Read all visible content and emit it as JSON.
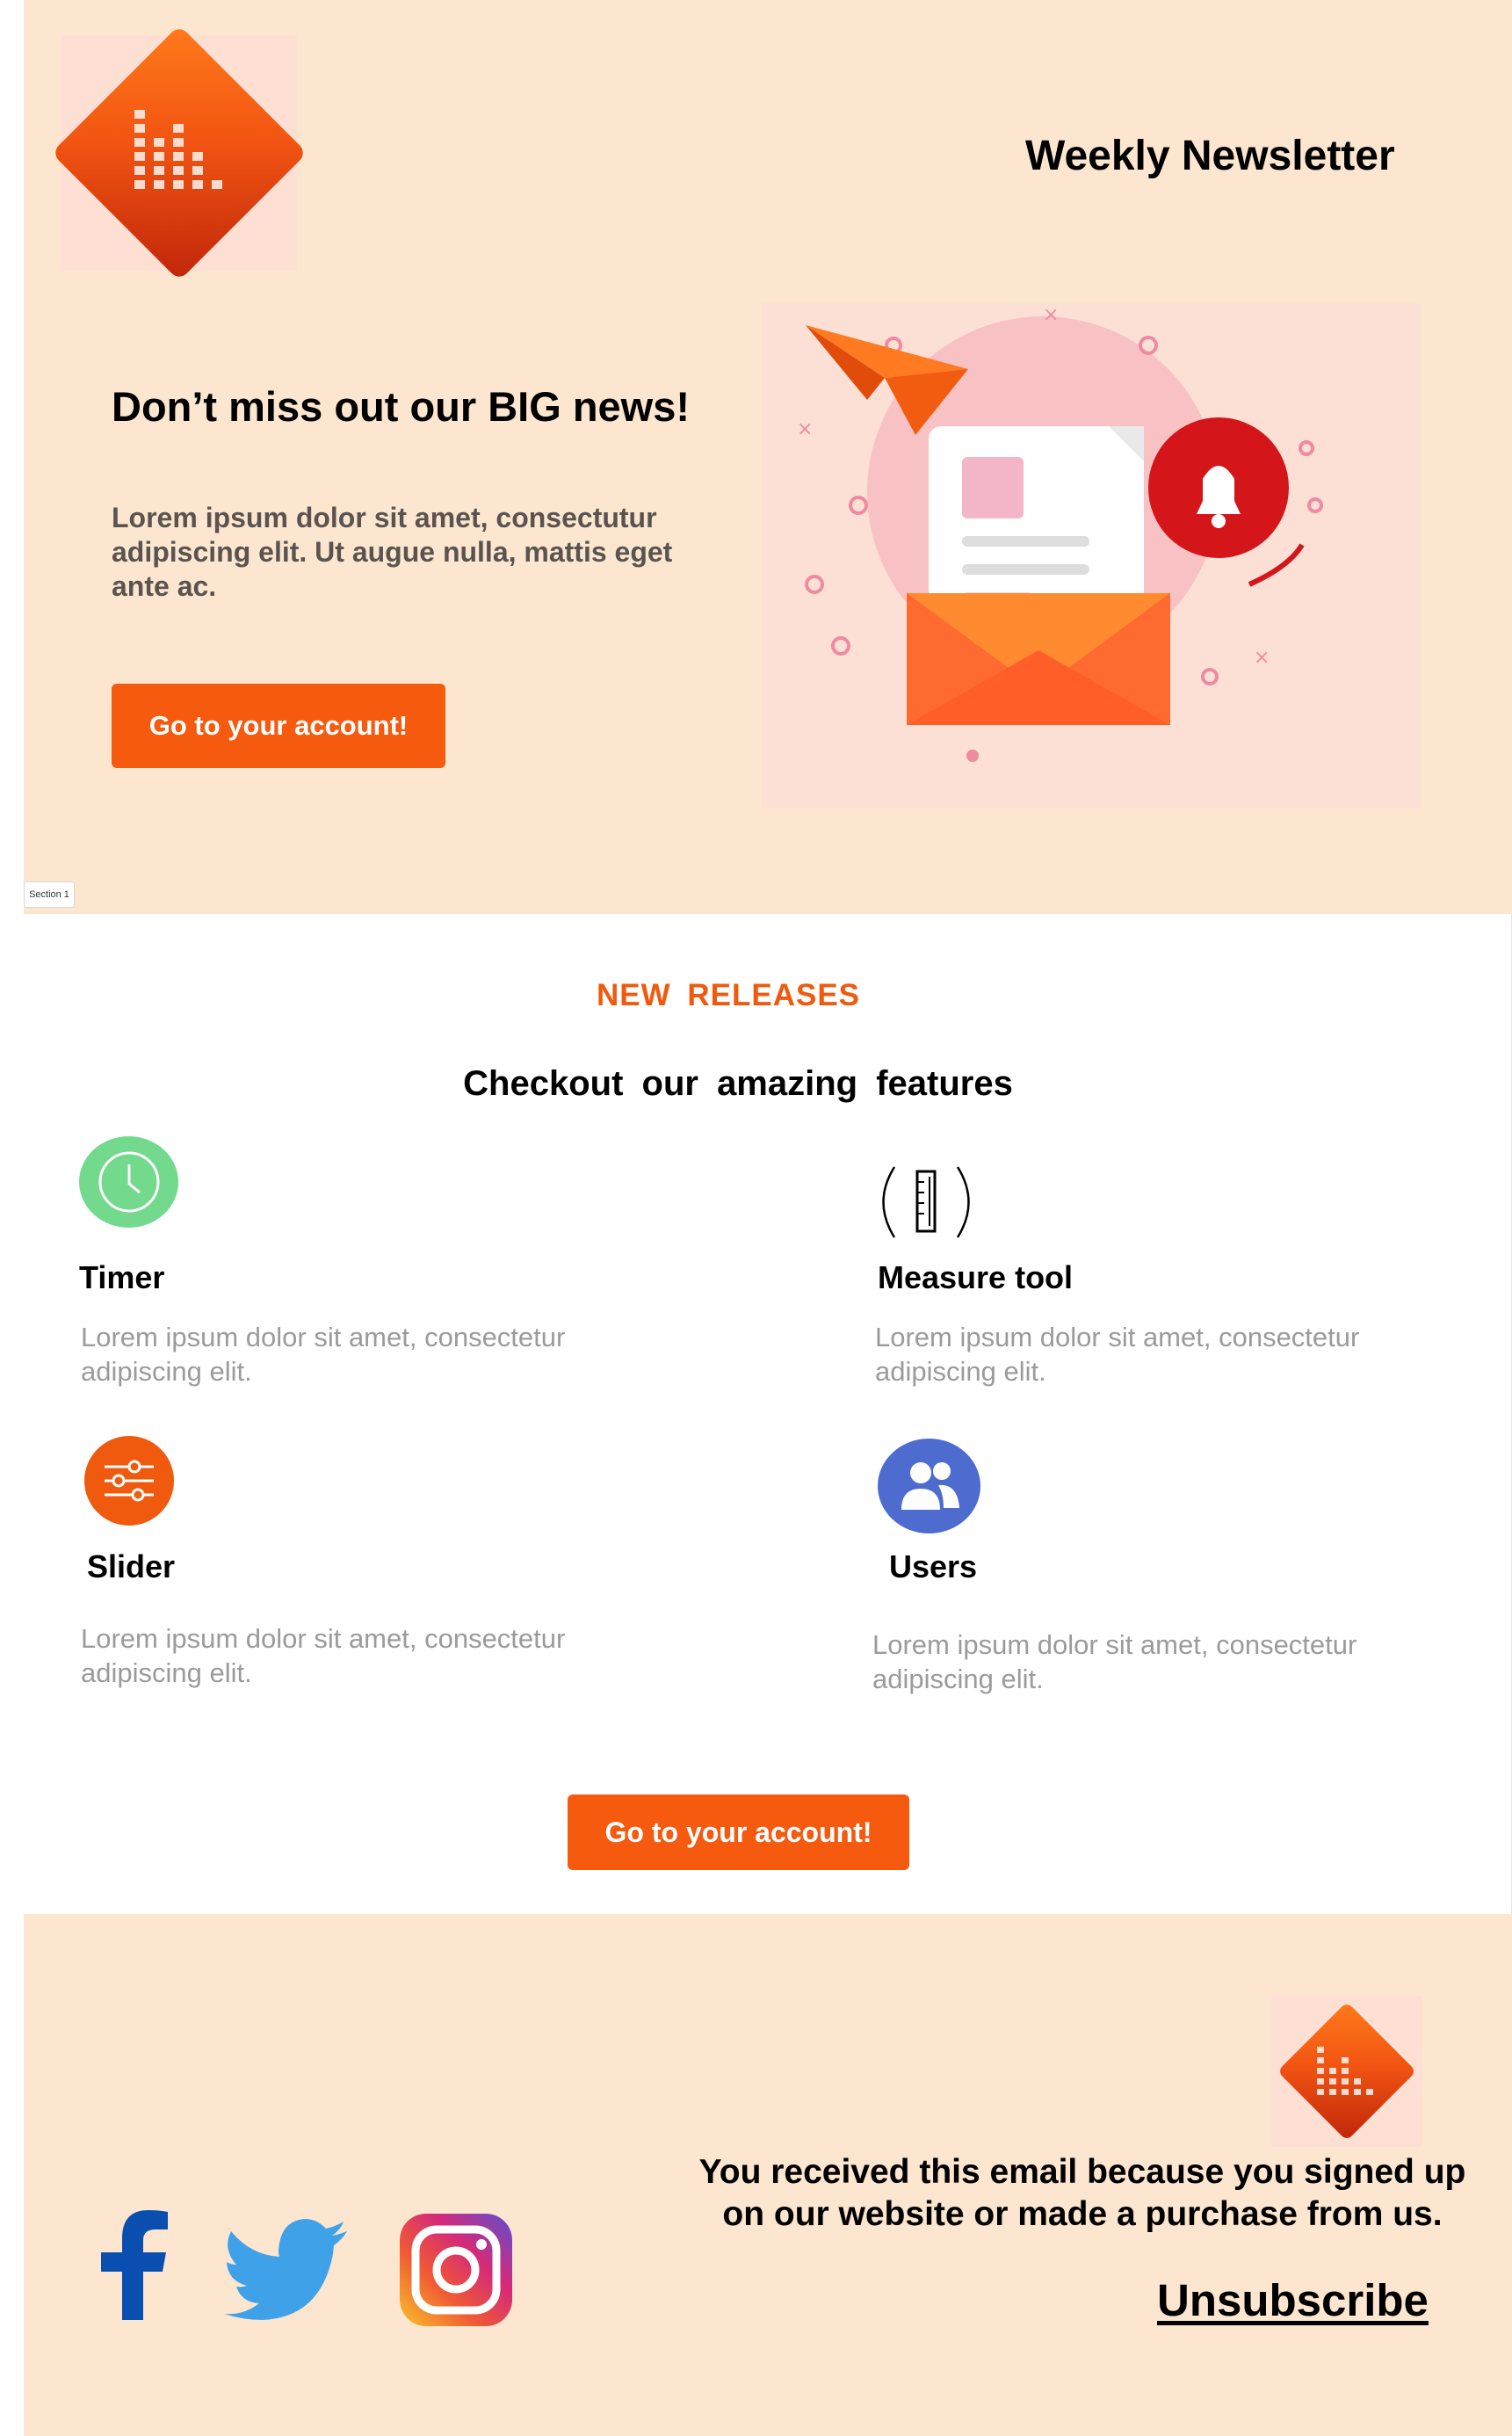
{
  "header": {
    "title": "Weekly Newsletter",
    "headline": "Don’t miss out our BIG news!",
    "body": "Lorem ipsum dolor sit amet,  consectutur adipiscing elit. Ut augue nulla, mattis eget ante ac.",
    "button_label": "Go to your account!",
    "section_tag": "Section 1"
  },
  "features": {
    "eyebrow": "NEW  RELEASES",
    "heading": "Checkout  our  amazing  features",
    "items": [
      {
        "icon": "clock-icon",
        "title": "Timer",
        "description": "Lorem  ipsum dolor sit amet,  consectetur adipiscing elit.",
        "color": "#6fd88a"
      },
      {
        "icon": "ruler-pencil-icon",
        "title": "Measure tool",
        "description": "Lorem  ipsum dolor sit amet,  consectetur adipiscing elit.",
        "color": "#000000"
      },
      {
        "icon": "sliders-icon",
        "title": "Slider",
        "description": "Lorem  ipsum dolor sit amet,  consectetur adipiscing elit.",
        "color": "#f05a0e"
      },
      {
        "icon": "users-icon",
        "title": "Users",
        "description": "Lorem  ipsum dolor sit amet,  consectetur adipiscing elit.",
        "color": "#4a6ad0"
      }
    ],
    "button_label": "Go to your account!"
  },
  "footer": {
    "note": "You received this email because you signed up on our website or made a purchase from us.",
    "unsubscribe": "Unsubscribe",
    "social": [
      "facebook-icon",
      "twitter-icon",
      "instagram-icon"
    ]
  },
  "colors": {
    "accent": "#f55a0e",
    "background": "#fde6cf"
  }
}
